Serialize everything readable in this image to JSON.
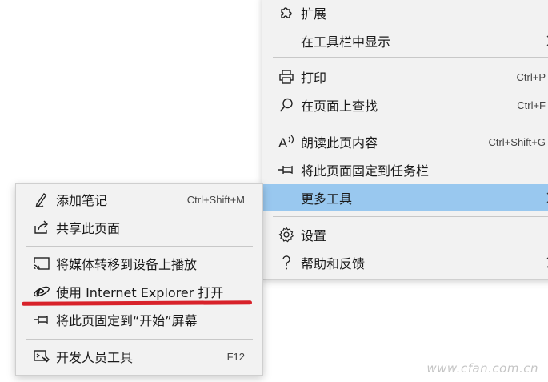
{
  "main_menu": {
    "items": [
      {
        "icon": "puzzle-icon",
        "label": "扩展",
        "shortcut": ""
      },
      {
        "icon": "",
        "label": "在工具栏中显示",
        "shortcut": "",
        "submenu": true
      },
      {
        "icon": "printer-icon",
        "label": "打印",
        "shortcut": "Ctrl+P"
      },
      {
        "icon": "search-icon",
        "label": "在页面上查找",
        "shortcut": "Ctrl+F"
      },
      {
        "icon": "read-aloud-icon",
        "label": "朗读此页内容",
        "shortcut": "Ctrl+Shift+G"
      },
      {
        "icon": "pin-icon",
        "label": "将此页面固定到任务栏",
        "shortcut": ""
      },
      {
        "icon": "",
        "label": "更多工具",
        "shortcut": "",
        "submenu": true,
        "highlighted": true
      },
      {
        "icon": "gear-icon",
        "label": "设置",
        "shortcut": ""
      },
      {
        "icon": "question-icon",
        "label": "帮助和反馈",
        "shortcut": "",
        "submenu": true
      }
    ],
    "read_aloud_glyph": "A"
  },
  "sub_menu": {
    "items": [
      {
        "icon": "pen-icon",
        "label": "添加笔记",
        "shortcut": "Ctrl+Shift+M"
      },
      {
        "icon": "share-icon",
        "label": "共享此页面",
        "shortcut": ""
      },
      {
        "icon": "cast-icon",
        "label": "将媒体转移到设备上播放",
        "shortcut": ""
      },
      {
        "icon": "ie-icon",
        "label": "使用 Internet Explorer 打开",
        "shortcut": ""
      },
      {
        "icon": "pin-icon",
        "label": "将此页固定到“开始”屏幕",
        "shortcut": ""
      },
      {
        "icon": "devtools-icon",
        "label": "开发人员工具",
        "shortcut": "F12"
      }
    ]
  },
  "watermark": "www.cfan.com.cn",
  "colors": {
    "highlight": "#99c8ef",
    "annotation": "#d8222a",
    "menu_bg": "#f2f2f2"
  }
}
